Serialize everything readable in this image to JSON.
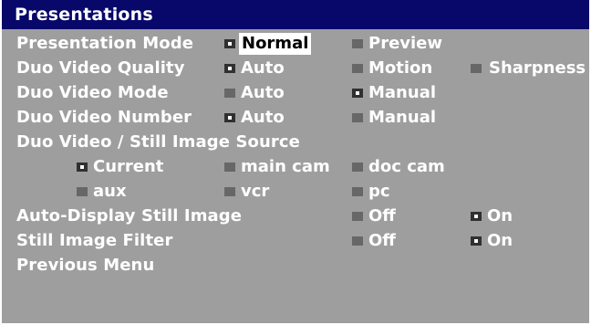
{
  "title": "Presentations",
  "colors": {
    "titlebar_bg": "#08086b",
    "panel_bg": "#9e9e9e",
    "text": "#ffffff",
    "unselected_box": "#676767",
    "selected_box": "#303030",
    "highlight_bg": "#ffffff"
  },
  "rows": {
    "presentation_mode": {
      "label": "Presentation Mode",
      "options": [
        {
          "label": "Normal",
          "selected": true,
          "highlighted": true
        },
        {
          "label": "Preview",
          "selected": false
        }
      ]
    },
    "duo_video_quality": {
      "label": "Duo Video Quality",
      "options": [
        {
          "label": "Auto",
          "selected": true
        },
        {
          "label": "Motion",
          "selected": false
        },
        {
          "label": "Sharpness",
          "selected": false
        }
      ]
    },
    "duo_video_mode": {
      "label": "Duo Video Mode",
      "options": [
        {
          "label": "Auto",
          "selected": false
        },
        {
          "label": "Manual",
          "selected": true
        }
      ]
    },
    "duo_video_number": {
      "label": "Duo Video Number",
      "options": [
        {
          "label": "Auto",
          "selected": true
        },
        {
          "label": "Manual",
          "selected": false
        }
      ]
    },
    "source": {
      "label": "Duo Video / Still Image Source",
      "options": [
        {
          "label": "Current",
          "selected": true
        },
        {
          "label": "main cam",
          "selected": false
        },
        {
          "label": "doc cam",
          "selected": false
        },
        {
          "label": "aux",
          "selected": false
        },
        {
          "label": "vcr",
          "selected": false
        },
        {
          "label": "pc",
          "selected": false
        }
      ]
    },
    "auto_display": {
      "label": "Auto-Display Still Image",
      "options": [
        {
          "label": "Off",
          "selected": false
        },
        {
          "label": "On",
          "selected": true
        }
      ]
    },
    "still_filter": {
      "label": "Still Image Filter",
      "options": [
        {
          "label": "Off",
          "selected": false
        },
        {
          "label": "On",
          "selected": true
        }
      ]
    },
    "previous_menu": {
      "label": "Previous Menu"
    }
  }
}
